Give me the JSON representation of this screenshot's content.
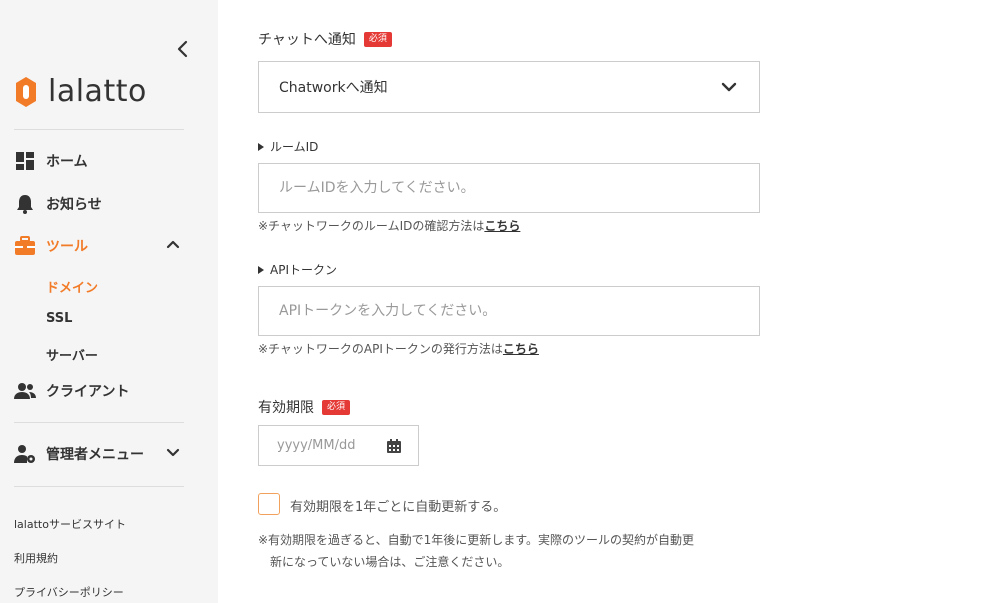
{
  "sidebar": {
    "logo_text": "lalatto",
    "nav": {
      "home": "ホーム",
      "news": "お知らせ",
      "tools": "ツール",
      "clients": "クライアント",
      "admin": "管理者メニュー"
    },
    "tools_sub": [
      "ドメイン",
      "SSL",
      "サーバー"
    ],
    "footer": [
      "lalattoサービスサイト",
      "利用規約",
      "プライバシーポリシー"
    ]
  },
  "form": {
    "chat_notify": {
      "label": "チャットへ通知",
      "required": "必須",
      "selected": "Chatworkへ通知"
    },
    "room_id": {
      "label": "ルームID",
      "placeholder": "ルームIDを入力してください。",
      "note": "※チャットワークのルームIDの確認方法は",
      "link": "こちら"
    },
    "api_token": {
      "label": "APIトークン",
      "placeholder": "APIトークンを入力してください。",
      "note": "※チャットワークのAPIトークンの発行方法は",
      "link": "こちら"
    },
    "expiry": {
      "label": "有効期限",
      "required": "必須",
      "placeholder": "yyyy/MM/dd"
    },
    "auto_renew": {
      "label": "有効期限を1年ごとに自動更新する。",
      "checked": false
    },
    "notice_line1": "※有効期限を過ぎると、自動で1年後に更新します。実際のツールの契約が自動更",
    "notice_line2": "新になっていない場合は、ご注意ください。"
  },
  "colors": {
    "accent": "#f27b28",
    "required_badge": "#e53935",
    "sidebar_bg": "#f5f5f5"
  }
}
